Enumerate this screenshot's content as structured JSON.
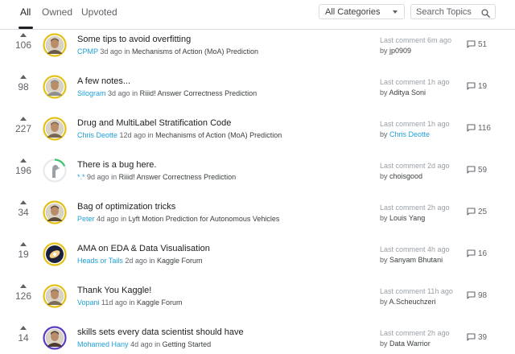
{
  "tabs": [
    {
      "label": "All",
      "active": true
    },
    {
      "label": "Owned",
      "active": false
    },
    {
      "label": "Upvoted",
      "active": false
    }
  ],
  "filter": {
    "selected": "All Categories"
  },
  "search": {
    "placeholder": "Search Topics"
  },
  "colors": {
    "link": "#20a0d8",
    "ring": "#e2c21a",
    "ring_alt": "#5b3cc4",
    "progress_green": "#3cc46e"
  },
  "topics": [
    {
      "votes": "106",
      "title": "Some tips to avoid overfitting",
      "author": "CPMP",
      "age": "3d ago",
      "in_word": "in",
      "competition": "Mechanisms of Action (MoA) Prediction",
      "last_label": "Last comment",
      "last_time": "6m ago",
      "by_word": "by",
      "last_user": "jp0909",
      "comments": "51",
      "avatar_icon": "user-photo-icon"
    },
    {
      "votes": "98",
      "title": "A few notes...",
      "author": "Silogram",
      "age": "3d ago",
      "in_word": "in",
      "competition": "Riiid! Answer Correctness Prediction",
      "last_label": "Last comment",
      "last_time": "1h ago",
      "by_word": "by",
      "last_user": "Aditya Soni",
      "comments": "19",
      "avatar_icon": "user-photo-icon"
    },
    {
      "votes": "227",
      "title": "Drug and MultiLabel Stratification Code",
      "author": "Chris Deotte",
      "age": "12d ago",
      "in_word": "in",
      "competition": "Mechanisms of Action (MoA) Prediction",
      "last_label": "Last comment",
      "last_time": "1h ago",
      "by_word": "by",
      "last_user": "Chris Deotte",
      "comments": "116",
      "avatar_icon": "user-photo-icon"
    },
    {
      "votes": "196",
      "title": "There is a bug here.",
      "author": "*.*",
      "age": "9d ago",
      "in_word": "in",
      "competition": "Riiid! Answer Correctness Prediction",
      "last_label": "Last comment",
      "last_time": "2d ago",
      "by_word": "by",
      "last_user": "choisgood",
      "comments": "59",
      "avatar_icon": "bird-icon"
    },
    {
      "votes": "34",
      "title": "Bag of optimization tricks",
      "author": "Peter",
      "age": "4d ago",
      "in_word": "in",
      "competition": "Lyft Motion Prediction for Autonomous Vehicles",
      "last_label": "Last comment",
      "last_time": "2h ago",
      "by_word": "by",
      "last_user": "Louis Yang",
      "comments": "25",
      "avatar_icon": "user-photo-icon"
    },
    {
      "votes": "19",
      "title": "AMA on EDA & Data Visualisation",
      "author": "Heads or Tails",
      "age": "2d ago",
      "in_word": "in",
      "competition": "Kaggle Forum",
      "last_label": "Last comment",
      "last_time": "4h ago",
      "by_word": "by",
      "last_user": "Sanyam Bhutani",
      "comments": "16",
      "avatar_icon": "galaxy-icon"
    },
    {
      "votes": "126",
      "title": "Thank You Kaggle!",
      "author": "Vopani",
      "age": "11d ago",
      "in_word": "in",
      "competition": "Kaggle Forum",
      "last_label": "Last comment",
      "last_time": "11h ago",
      "by_word": "by",
      "last_user": "A.Scheuchzeri",
      "comments": "98",
      "avatar_icon": "user-photo-icon"
    },
    {
      "votes": "14",
      "title": "skills sets every data scientist should have",
      "author": "Mohamed Hany",
      "age": "4d ago",
      "in_word": "in",
      "competition": "Getting Started",
      "last_label": "Last comment",
      "last_time": "2h ago",
      "by_word": "by",
      "last_user": "Data Warrior",
      "comments": "39",
      "avatar_icon": "user-photo-icon"
    }
  ]
}
